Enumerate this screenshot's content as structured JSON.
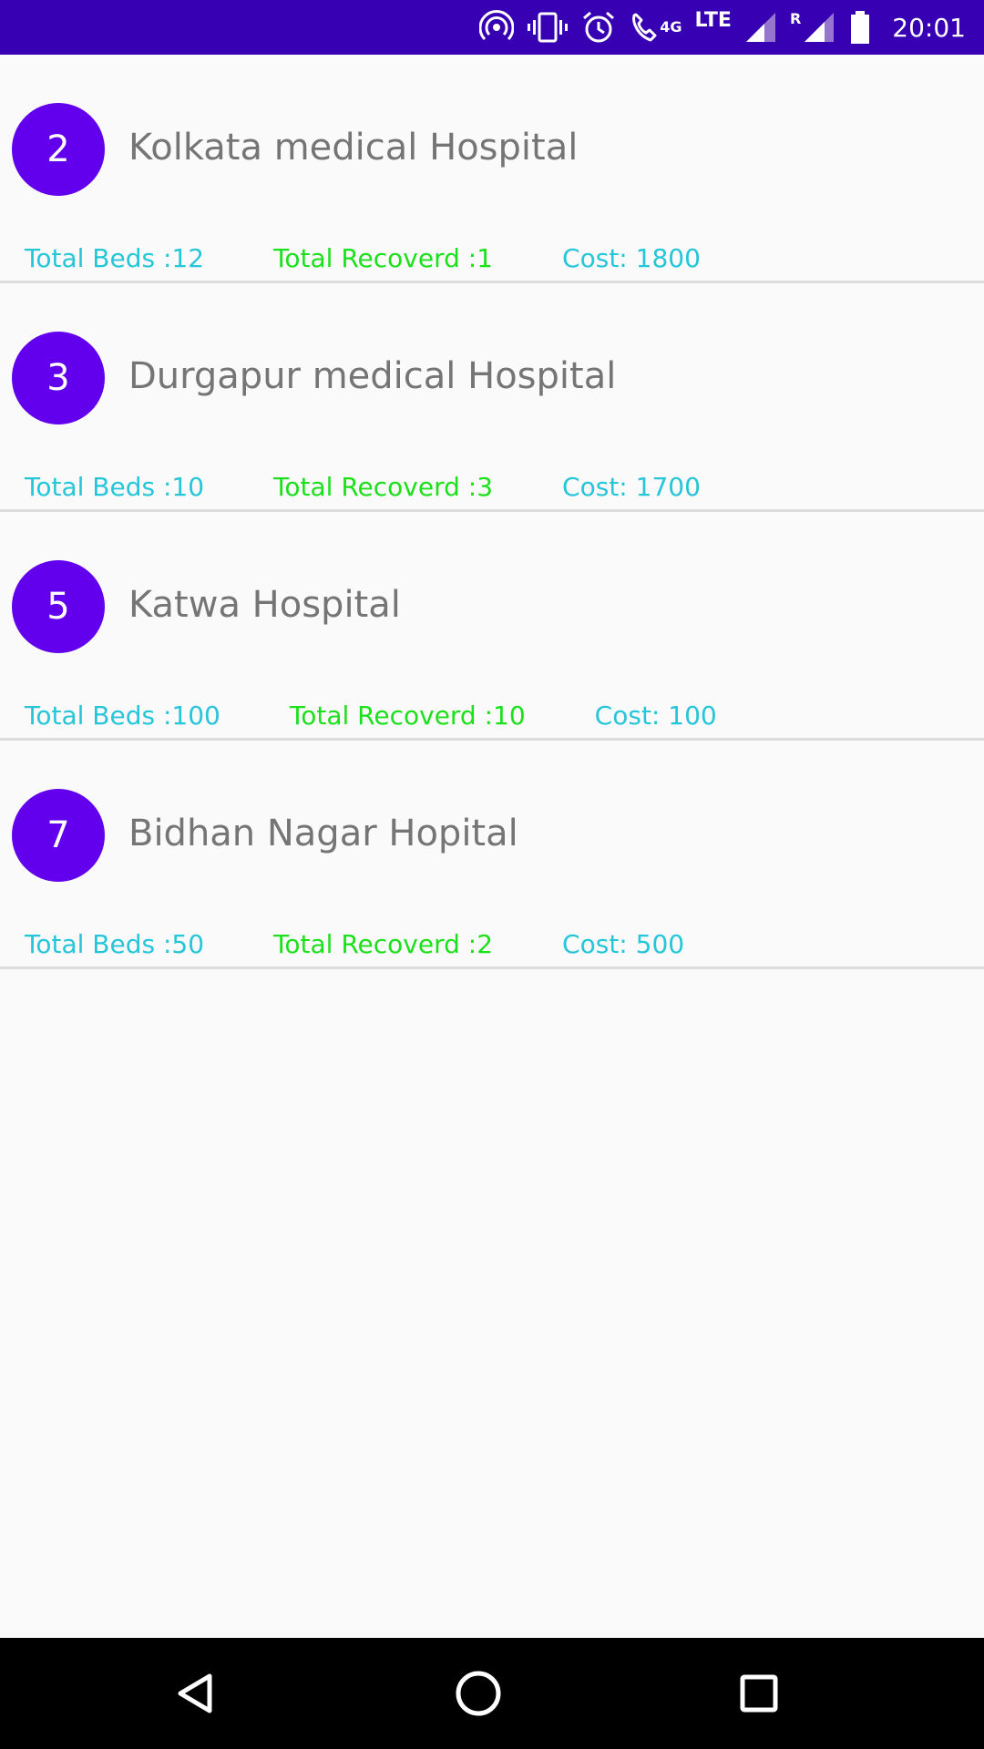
{
  "status_bar": {
    "time": "20:01",
    "network_4g": "4G",
    "network_lte": "LTE",
    "roaming": "R",
    "icons": [
      "hotspot-icon",
      "vibrate-icon",
      "alarm-icon",
      "wifi-calling-icon",
      "signal-icon",
      "signal-roaming-icon",
      "battery-icon"
    ]
  },
  "hospitals": [
    {
      "id": "2",
      "name": "Kolkata medical Hospital",
      "beds": "Total Beds :12",
      "recovered": "Total Recoverd :1",
      "cost": "Cost: 1800"
    },
    {
      "id": "3",
      "name": "Durgapur medical Hospital",
      "beds": "Total Beds :10",
      "recovered": "Total Recoverd :3",
      "cost": "Cost: 1700"
    },
    {
      "id": "5",
      "name": "Katwa Hospital",
      "beds": "Total Beds :100",
      "recovered": "Total Recoverd :10",
      "cost": "Cost: 100"
    },
    {
      "id": "7",
      "name": "Bidhan Nagar Hopital",
      "beds": "Total Beds :50",
      "recovered": "Total Recoverd :2",
      "cost": "Cost: 500"
    }
  ],
  "colors": {
    "status_bar": "#3700b3",
    "badge": "#6200ee",
    "beds_text": "#26c6da",
    "recovered_text": "#1ce01c",
    "cost_text": "#26c6da",
    "title_text": "#757575",
    "background": "#fafafa"
  },
  "nav_bar": {
    "buttons": [
      "back-icon",
      "home-icon",
      "recents-icon"
    ]
  }
}
